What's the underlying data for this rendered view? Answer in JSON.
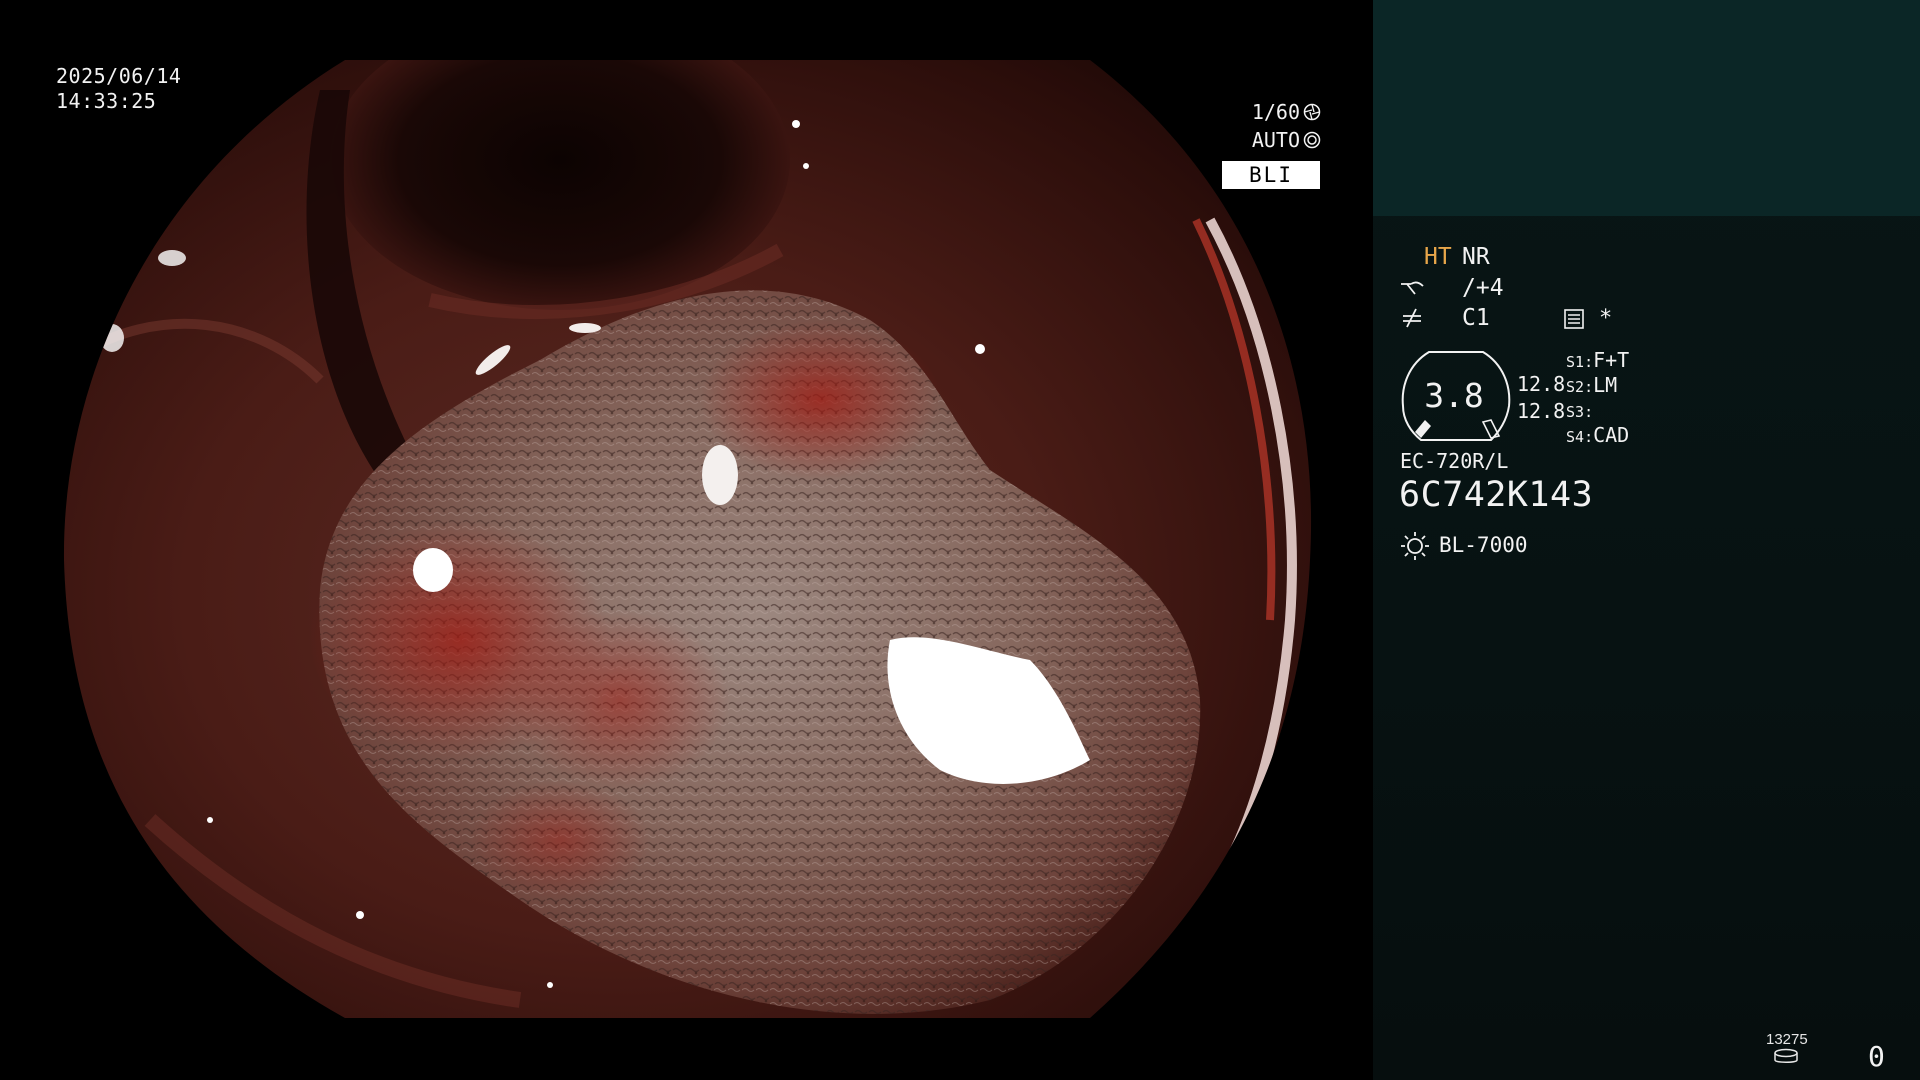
{
  "overlay": {
    "date": "2025/06/14",
    "time": "14:33:25",
    "shutter": "1/60",
    "shutter_icon": "aperture-icon",
    "iris": "AUTO",
    "iris_icon": "iris-icon",
    "mode": "BLI"
  },
  "panel": {
    "ht": "HT",
    "nr": "NR",
    "enhancement": "/+4",
    "enhancement_icon": "structure-enhancement-icon",
    "color_mode": "C1",
    "color_icon": "color-enhancement-icon",
    "memo_icon": "memo-icon",
    "star": "*",
    "zoom": "3.8",
    "focal_1": "12.8",
    "focal_2": "12.8",
    "switches": [
      {
        "key": "S1",
        "value": "F+T"
      },
      {
        "key": "S2",
        "value": "LM"
      },
      {
        "key": "S3",
        "value": ""
      },
      {
        "key": "S4",
        "value": "CAD"
      }
    ],
    "scope_model": "EC-720R/L",
    "scope_serial": "6C742K143",
    "light_icon": "light-source-icon",
    "light_source": "BL-7000",
    "image_count": "13275",
    "disk_icon": "storage-icon",
    "counter": "0"
  },
  "colors": {
    "ht_accent": "#e8a64a",
    "panel_bg": "#071212",
    "thumb_bg": "#0b2626"
  }
}
